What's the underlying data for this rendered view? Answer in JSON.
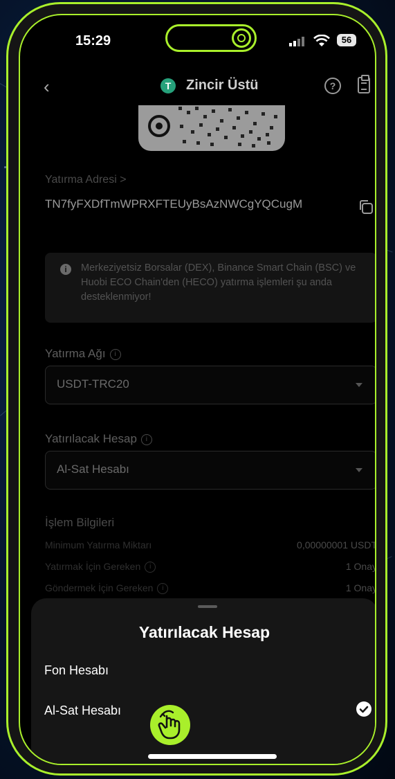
{
  "status_bar": {
    "time": "15:29",
    "battery": "56"
  },
  "header": {
    "title": "Zincir Üstü",
    "coin_icon": "tether-icon",
    "back_icon": "chevron-left-icon",
    "help_icon": "question-icon",
    "history_icon": "clipboard-icon"
  },
  "deposit_address": {
    "label": "Yatırma Adresi >",
    "value": "TN7fyFXDfTmWPRXFTEUyBsAzNWCgYQCugM",
    "copy_icon": "copy-icon"
  },
  "notice": {
    "icon": "info-icon",
    "text": "Merkeziyetsiz Borsalar (DEX), Binance Smart Chain (BSC) ve Huobi ECO Chain'den (HECO) yatırma işlemleri şu anda desteklenmiyor!"
  },
  "network": {
    "label": "Yatırma Ağı",
    "value": "USDT-TRC20"
  },
  "account": {
    "label": "Yatırılacak Hesap",
    "value": "Al-Sat Hesabı"
  },
  "transaction_info": {
    "title": "İşlem Bilgileri",
    "rows": [
      {
        "label": "Minimum Yatırma Miktarı",
        "value": "0,00000001 USDT"
      },
      {
        "label": "Yatırmak İçin Gereken",
        "value": "1 Onay"
      },
      {
        "label": "Göndermek İçin Gereken",
        "value": "1 Onay"
      }
    ]
  },
  "sheet": {
    "title": "Yatırılacak Hesap",
    "options": [
      {
        "label": "Fon Hesabı",
        "selected": false
      },
      {
        "label": "Al-Sat Hesabı",
        "selected": true
      }
    ]
  },
  "colors": {
    "accent": "#a9ef2b",
    "tether": "#26a17b",
    "background": "#000000"
  }
}
